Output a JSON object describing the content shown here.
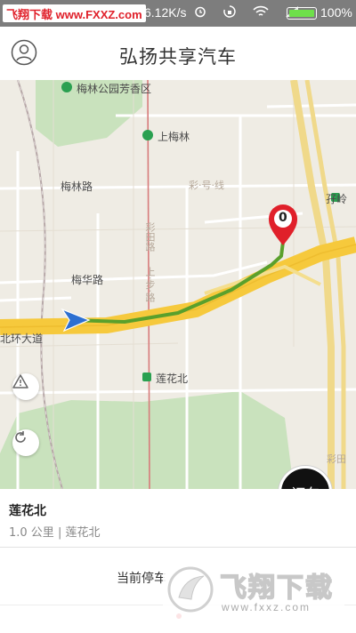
{
  "status_bar": {
    "watermark": "飞翔下载 www.FXXZ.com",
    "speed": "6.12K/s",
    "battery": "100%",
    "battery_color": "#6ee04a",
    "icons": [
      "alarm-icon",
      "rotate-lock-icon",
      "wifi-icon",
      "signal-icon",
      "battery-icon"
    ]
  },
  "header": {
    "title": "弘扬共享汽车",
    "avatar_icon": "user-icon"
  },
  "map": {
    "labels": {
      "park": "梅林公园芳香区",
      "metro_shanglin": "上梅林",
      "road_meilin": "梅林路",
      "road_meilin_b": "彩·号·线",
      "station_zailing": "孖岭",
      "road_meihua": "梅华路",
      "road_beihuan": "北环大道",
      "station_lianhuabei": "莲花北",
      "road_vertical": "彩田路",
      "road_vertical_b": "彩田",
      "road_vertical_c": "上·步·路"
    },
    "pin_number": "0",
    "warning_icon": "warning-icon",
    "refresh_icon": "refresh-icon",
    "location_icon": "navigation-arrow-icon",
    "order_button": "订车",
    "colors": {
      "route": "#5aa02c",
      "highway": "#f6c93c",
      "green_area": "#c9e2bd",
      "pin": "#e0202a"
    }
  },
  "station": {
    "name": "莲花北",
    "detail": "1.0 公里 | 莲花北"
  },
  "bottom": {
    "text": "当前停车",
    "watermark_big": "飞翔下载",
    "watermark_url": "www.fxxz.com"
  }
}
